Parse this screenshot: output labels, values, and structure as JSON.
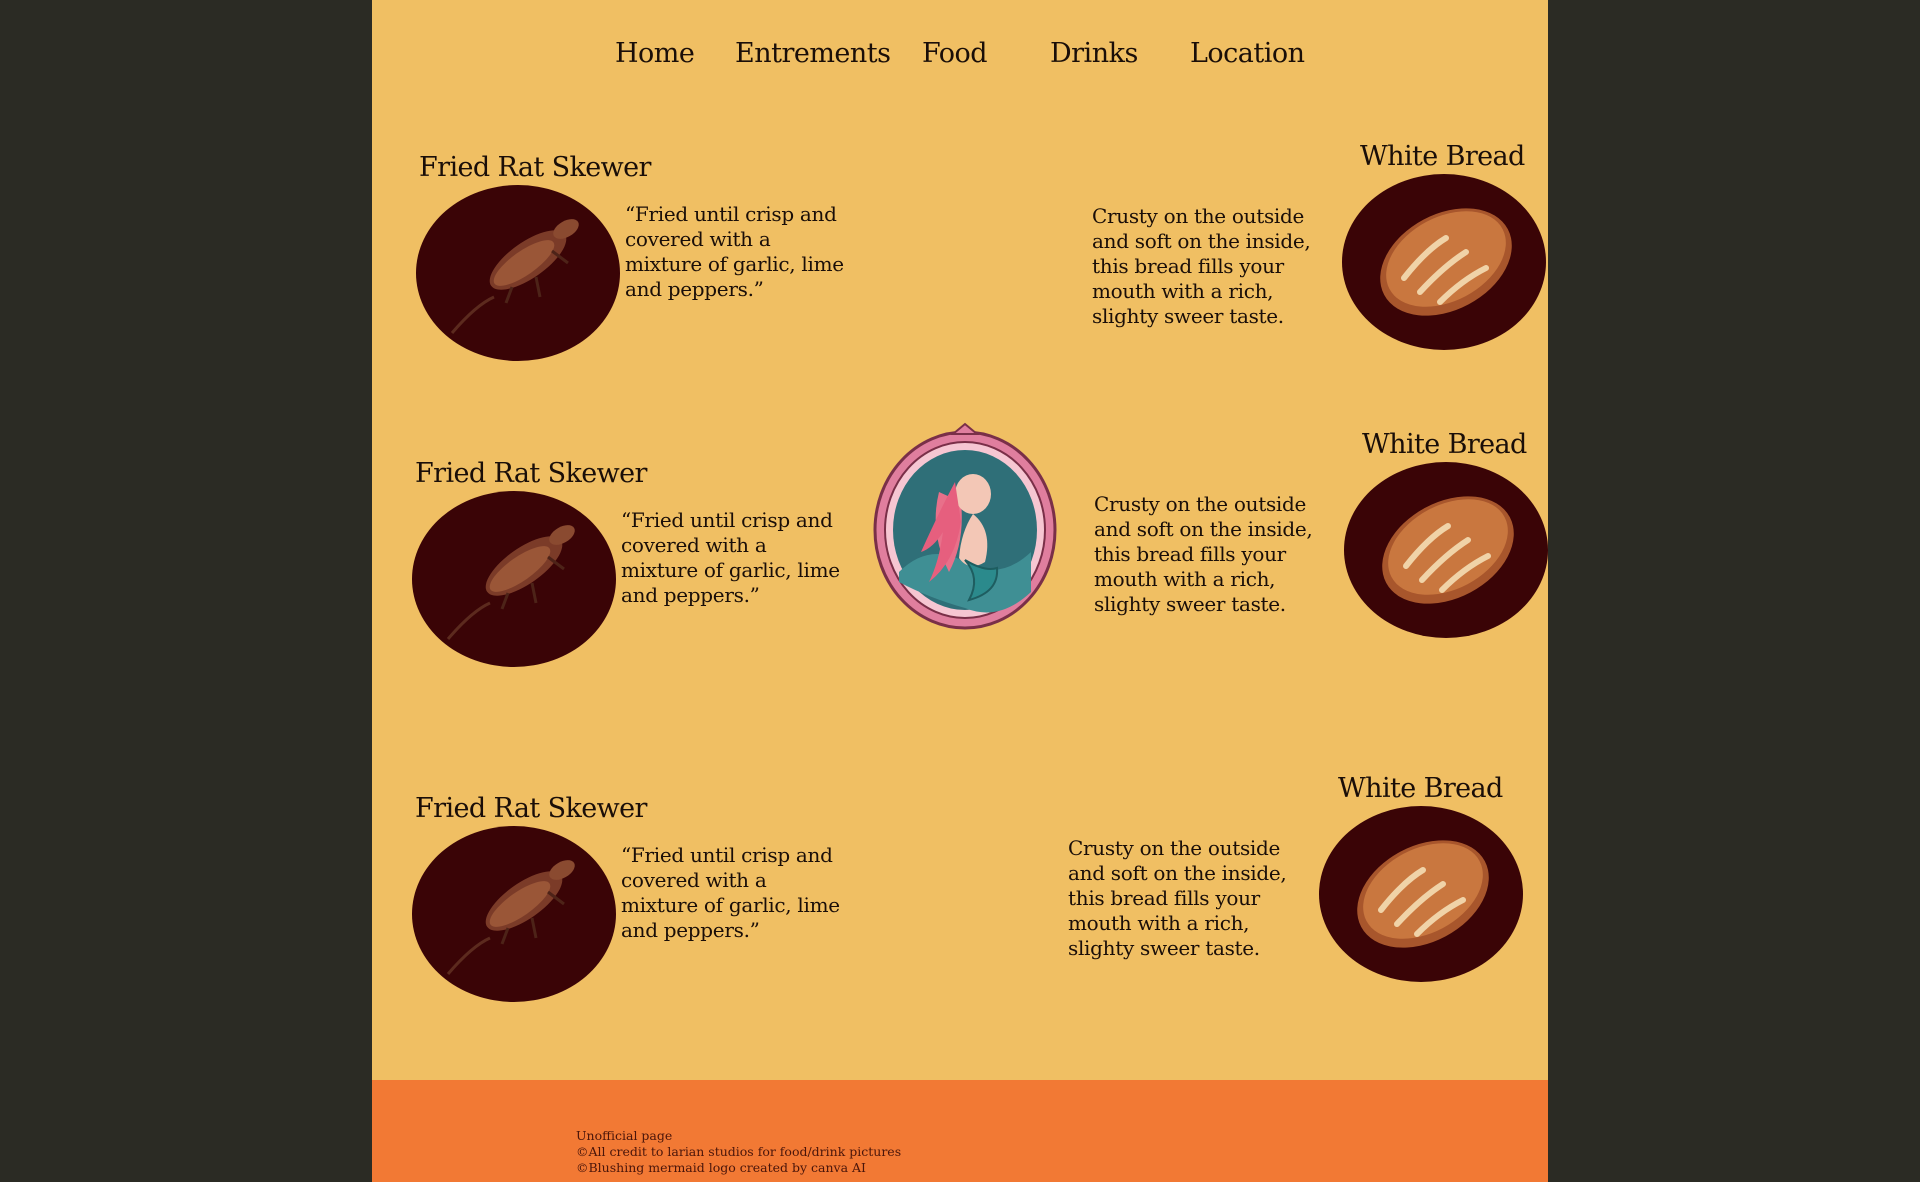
{
  "nav": {
    "items": [
      "Home",
      "Entrements",
      "Food",
      "Drinks",
      "Location"
    ]
  },
  "menu": {
    "left_items": [
      {
        "title": "Fried Rat Skewer",
        "description": "“Fried until crisp and covered with a mixture of garlic, lime and peppers.”",
        "icon": "rat-icon"
      },
      {
        "title": "Fried Rat Skewer",
        "description": "“Fried until crisp and covered with a mixture of garlic, lime and peppers.”",
        "icon": "rat-icon"
      },
      {
        "title": "Fried Rat Skewer",
        "description": "“Fried until crisp and covered with a mixture of garlic, lime and peppers.”",
        "icon": "rat-icon"
      }
    ],
    "right_items": [
      {
        "title": "White Bread",
        "description": "Crusty on the outside and soft on the inside, this bread fills your mouth with a rich, slighty sweer taste.",
        "icon": "bread-icon"
      },
      {
        "title": "White Bread",
        "description": "Crusty on the outside and soft on the inside, this bread fills your mouth with a rich, slighty sweer taste.",
        "icon": "bread-icon"
      },
      {
        "title": "White Bread",
        "description": "Crusty on the outside and soft on the inside, this bread fills your mouth with a rich, slighty sweer taste.",
        "icon": "bread-icon"
      }
    ]
  },
  "logo": {
    "icon": "mermaid-logo-icon"
  },
  "footer": {
    "lines": [
      "Unofficial page",
      "©All credit  to larian studios for  food/drink pictures",
      "©Blushing mermaid logo created by canva AI"
    ]
  },
  "colors": {
    "page_background": "#f0bf63",
    "outer_background": "#2b2b24",
    "footer_background": "#f27934",
    "plate": "#3a0406",
    "text": "#1a0e08"
  }
}
